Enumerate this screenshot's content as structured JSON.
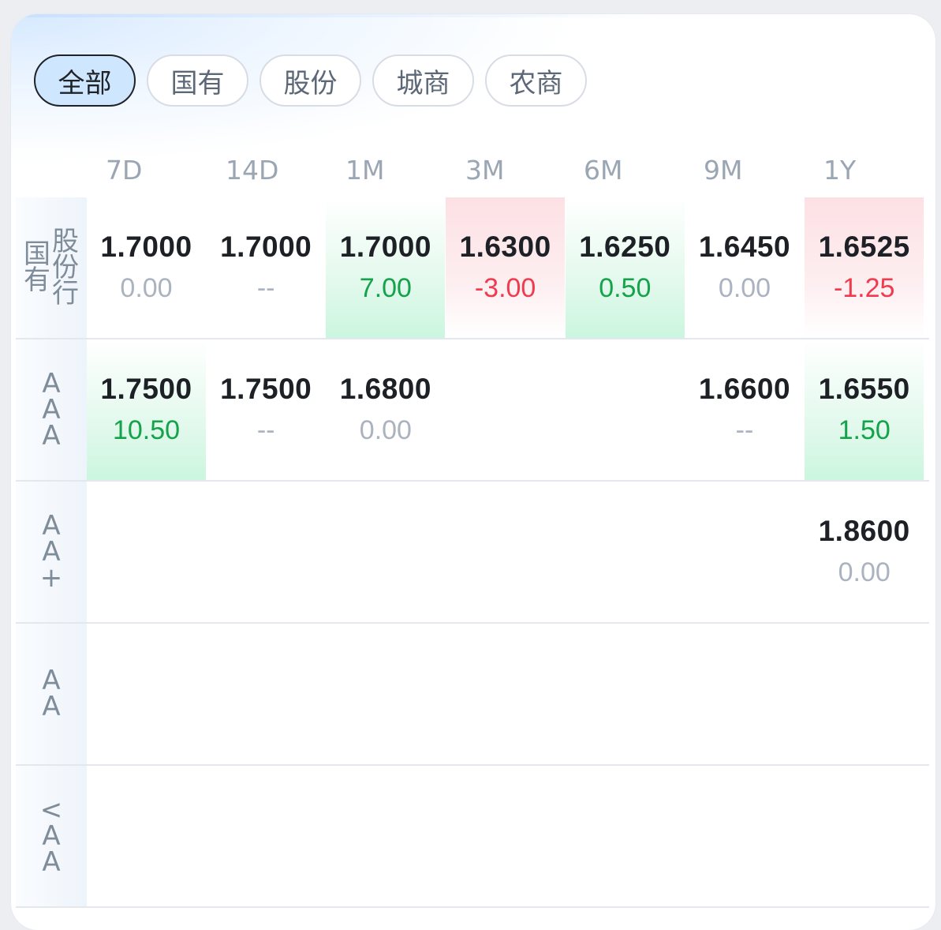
{
  "tabs": [
    {
      "label": "全部",
      "active": true
    },
    {
      "label": "国有",
      "active": false
    },
    {
      "label": "股份",
      "active": false
    },
    {
      "label": "城商",
      "active": false
    },
    {
      "label": "农商",
      "active": false
    }
  ],
  "columns": [
    "7D",
    "14D",
    "1M",
    "3M",
    "6M",
    "9M",
    "1Y"
  ],
  "rows": [
    {
      "label_left": "国\n有",
      "label_right": "股\n份\n行",
      "cells": [
        {
          "rate": "1.7000",
          "change": "0.00",
          "trend": "flat",
          "highlight": ""
        },
        {
          "rate": "1.7000",
          "change": "--",
          "trend": "flat",
          "highlight": ""
        },
        {
          "rate": "1.7000",
          "change": "7.00",
          "trend": "pos",
          "highlight": "up"
        },
        {
          "rate": "1.6300",
          "change": "-3.00",
          "trend": "neg",
          "highlight": "down"
        },
        {
          "rate": "1.6250",
          "change": "0.50",
          "trend": "pos",
          "highlight": "up"
        },
        {
          "rate": "1.6450",
          "change": "0.00",
          "trend": "flat",
          "highlight": ""
        },
        {
          "rate": "1.6525",
          "change": "-1.25",
          "trend": "neg",
          "highlight": "down"
        }
      ]
    },
    {
      "label": "A\nA\nA",
      "cells": [
        {
          "rate": "1.7500",
          "change": "10.50",
          "trend": "pos",
          "highlight": "up"
        },
        {
          "rate": "1.7500",
          "change": "--",
          "trend": "flat",
          "highlight": ""
        },
        {
          "rate": "1.6800",
          "change": "0.00",
          "trend": "flat",
          "highlight": ""
        },
        null,
        null,
        {
          "rate": "1.6600",
          "change": "--",
          "trend": "flat",
          "highlight": ""
        },
        {
          "rate": "1.6550",
          "change": "1.50",
          "trend": "pos",
          "highlight": "up"
        }
      ]
    },
    {
      "label": "A\nA\n+",
      "cells": [
        null,
        null,
        null,
        null,
        null,
        null,
        {
          "rate": "1.8600",
          "change": "0.00",
          "trend": "flat",
          "highlight": ""
        }
      ]
    },
    {
      "label": "A\nA",
      "cells": [
        null,
        null,
        null,
        null,
        null,
        null,
        null
      ]
    },
    {
      "label": "<\nA\nA",
      "cells": [
        null,
        null,
        null,
        null,
        null,
        null,
        null
      ]
    }
  ],
  "colors": {
    "positive": "#14a24a",
    "negative": "#f23a4f",
    "neutral": "#aab3bf",
    "tab_active_bg": "#cfe6ff"
  }
}
